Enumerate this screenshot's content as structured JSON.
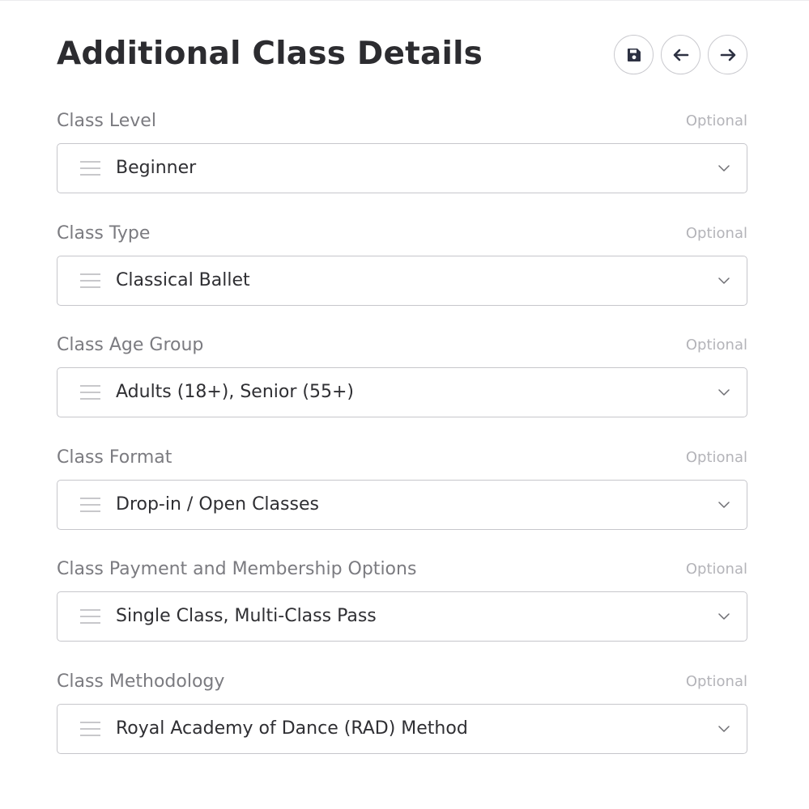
{
  "header": {
    "title": "Additional Class Details",
    "buttons": [
      {
        "name": "save",
        "icon": "save-icon"
      },
      {
        "name": "back",
        "icon": "arrow-left-icon"
      },
      {
        "name": "forward",
        "icon": "arrow-right-icon"
      }
    ]
  },
  "fields": [
    {
      "label": "Class Level",
      "optional": "Optional",
      "value": "Beginner"
    },
    {
      "label": "Class Type",
      "optional": "Optional",
      "value": "Classical Ballet"
    },
    {
      "label": "Class Age Group",
      "optional": "Optional",
      "value": "Adults (18+), Senior (55+)"
    },
    {
      "label": "Class Format",
      "optional": "Optional",
      "value": "Drop-in / Open Classes"
    },
    {
      "label": "Class Payment and Membership Options",
      "optional": "Optional",
      "value": "Single Class, Multi-Class Pass"
    },
    {
      "label": "Class Methodology",
      "optional": "Optional",
      "value": "Royal Academy of Dance (RAD) Method"
    }
  ],
  "colors": {
    "title": "#2c2c30",
    "label": "#7b7b80",
    "optional": "#b4b4b9",
    "border": "#c6c6cb",
    "icon": "#2d3142"
  }
}
